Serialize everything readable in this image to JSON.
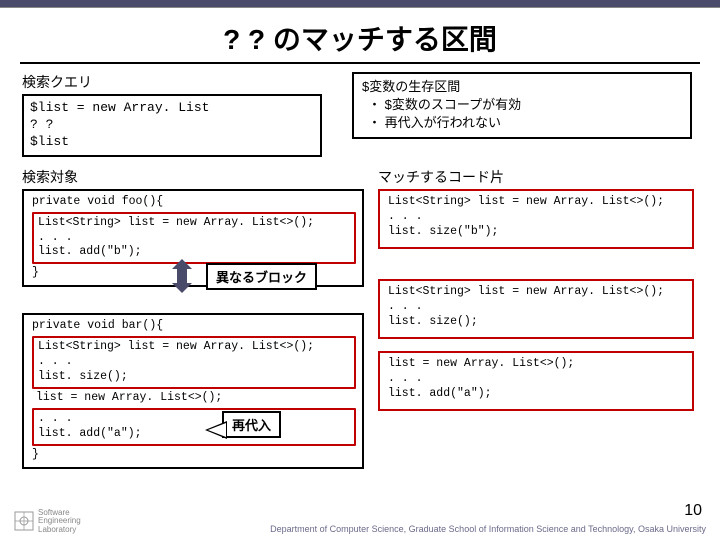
{
  "title": "? ? のマッチする区間",
  "query_label": "検索クエリ",
  "query_code": "$list = new Array. List\n? ?\n$list",
  "scope_title": "$変数の生存区間",
  "scope_items": [
    "$変数のスコープが有効",
    "再代入が行われない"
  ],
  "target_label": "検索対象",
  "match_label": "マッチするコード片",
  "code_l1_head": "private void foo(){",
  "code_l1_body": "List<String> list = new Array. List<>();\n. . .\nlist. add(\"b\");",
  "code_l1_tail": "}",
  "code_l2_head": "private void bar(){",
  "code_l2_body1": "List<String> list = new Array. List<>();\n. . .\nlist. size();",
  "code_l2_mid": "list = new Array. List<>();",
  "code_l2_body2": ". . .\nlist. add(\"a\");",
  "code_l2_tail": "}",
  "code_r1": "List<String> list = new Array. List<>();\n. . .\nlist. size(\"b\");",
  "code_r2": "List<String> list = new Array. List<>();\n. . .\nlist. size();",
  "code_r3": "list = new Array. List<>();\n. . .\nlist. add(\"a\");",
  "callout_diff": "異なるブロック",
  "callout_reassign": "再代入",
  "page_num": "10",
  "footer_logo_line1": "Software",
  "footer_logo_line2": "Engineering",
  "footer_logo_line3": "Laboratory",
  "footer_text": "Department of Computer Science, Graduate School of Information Science and Technology, Osaka University"
}
